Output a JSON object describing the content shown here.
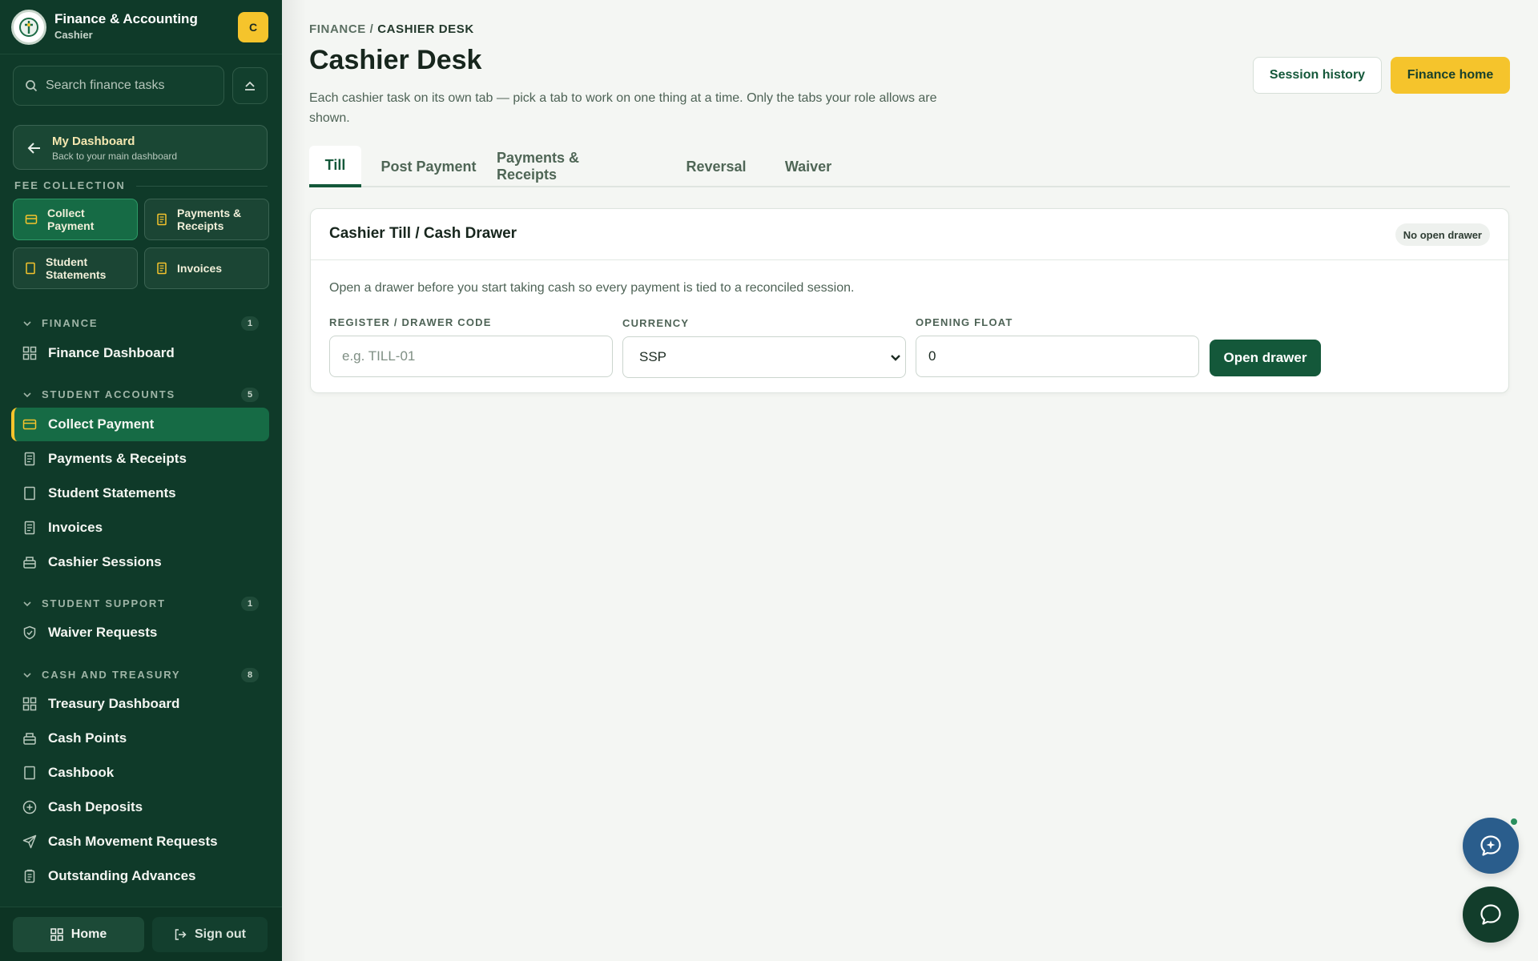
{
  "app": {
    "title": "Finance & Accounting",
    "role": "Cashier",
    "avatar": "C"
  },
  "search": {
    "placeholder": "Search finance tasks"
  },
  "dashboard": {
    "title": "My Dashboard",
    "subtitle": "Back to your main dashboard"
  },
  "fee_collection": {
    "label": "FEE COLLECTION",
    "items": [
      {
        "label": "Collect Payment",
        "icon": "card-icon",
        "active": true
      },
      {
        "label": "Payments & Receipts",
        "icon": "receipt-icon"
      },
      {
        "label": "Student Statements",
        "icon": "book-icon"
      },
      {
        "label": "Invoices",
        "icon": "invoice-icon"
      }
    ]
  },
  "sections": {
    "finance": {
      "label": "FINANCE",
      "count": "1",
      "items": [
        {
          "label": "Finance Dashboard",
          "icon": "grid-icon"
        }
      ]
    },
    "student_accounts": {
      "label": "STUDENT ACCOUNTS",
      "count": "5",
      "items": [
        {
          "label": "Collect Payment",
          "icon": "card-icon",
          "active": true
        },
        {
          "label": "Payments & Receipts",
          "icon": "receipt-icon"
        },
        {
          "label": "Student Statements",
          "icon": "book-icon"
        },
        {
          "label": "Invoices",
          "icon": "invoice-icon"
        },
        {
          "label": "Cashier Sessions",
          "icon": "register-icon"
        }
      ]
    },
    "student_support": {
      "label": "STUDENT SUPPORT",
      "count": "1",
      "items": [
        {
          "label": "Waiver Requests",
          "icon": "shield-icon"
        }
      ]
    },
    "cash_treasury": {
      "label": "CASH AND TREASURY",
      "count": "8",
      "items": [
        {
          "label": "Treasury Dashboard",
          "icon": "grid-icon"
        },
        {
          "label": "Cash Points",
          "icon": "register-icon"
        },
        {
          "label": "Cashbook",
          "icon": "book-icon"
        },
        {
          "label": "Cash Deposits",
          "icon": "plus-circle-icon"
        },
        {
          "label": "Cash Movement Requests",
          "icon": "send-icon"
        },
        {
          "label": "Outstanding Advances",
          "icon": "clipboard-icon"
        }
      ]
    }
  },
  "footer": {
    "home": "Home",
    "signout": "Sign out"
  },
  "breadcrumb": {
    "root": "FINANCE",
    "sep": "/",
    "current": "CASHIER DESK"
  },
  "page": {
    "title": "Cashier Desk",
    "description": "Each cashier task on its own tab — pick a tab to work on one thing at a time. Only the tabs your role allows are shown."
  },
  "actions": {
    "history": "Session history",
    "home": "Finance home"
  },
  "tabs": [
    {
      "label": "Till",
      "active": true
    },
    {
      "label": "Post Payment"
    },
    {
      "label": "Payments & Receipts"
    },
    {
      "label": "Reversal"
    },
    {
      "label": "Waiver"
    }
  ],
  "till": {
    "title": "Cashier Till / Cash Drawer",
    "status": "No open drawer",
    "note": "Open a drawer before you start taking cash so every payment is tied to a reconciled session.",
    "fields": {
      "register": {
        "label": "REGISTER / DRAWER CODE",
        "placeholder": "e.g. TILL-01",
        "value": ""
      },
      "currency": {
        "label": "CURRENCY",
        "value": "SSP"
      },
      "float": {
        "label": "OPENING FLOAT",
        "value": "0"
      }
    },
    "submit": "Open drawer"
  },
  "colors": {
    "sidebar": "#0f3a29",
    "accent": "#14583a",
    "active": "#166b45",
    "yellow": "#f5c42c",
    "chat_fab": "#2a5d8c"
  }
}
